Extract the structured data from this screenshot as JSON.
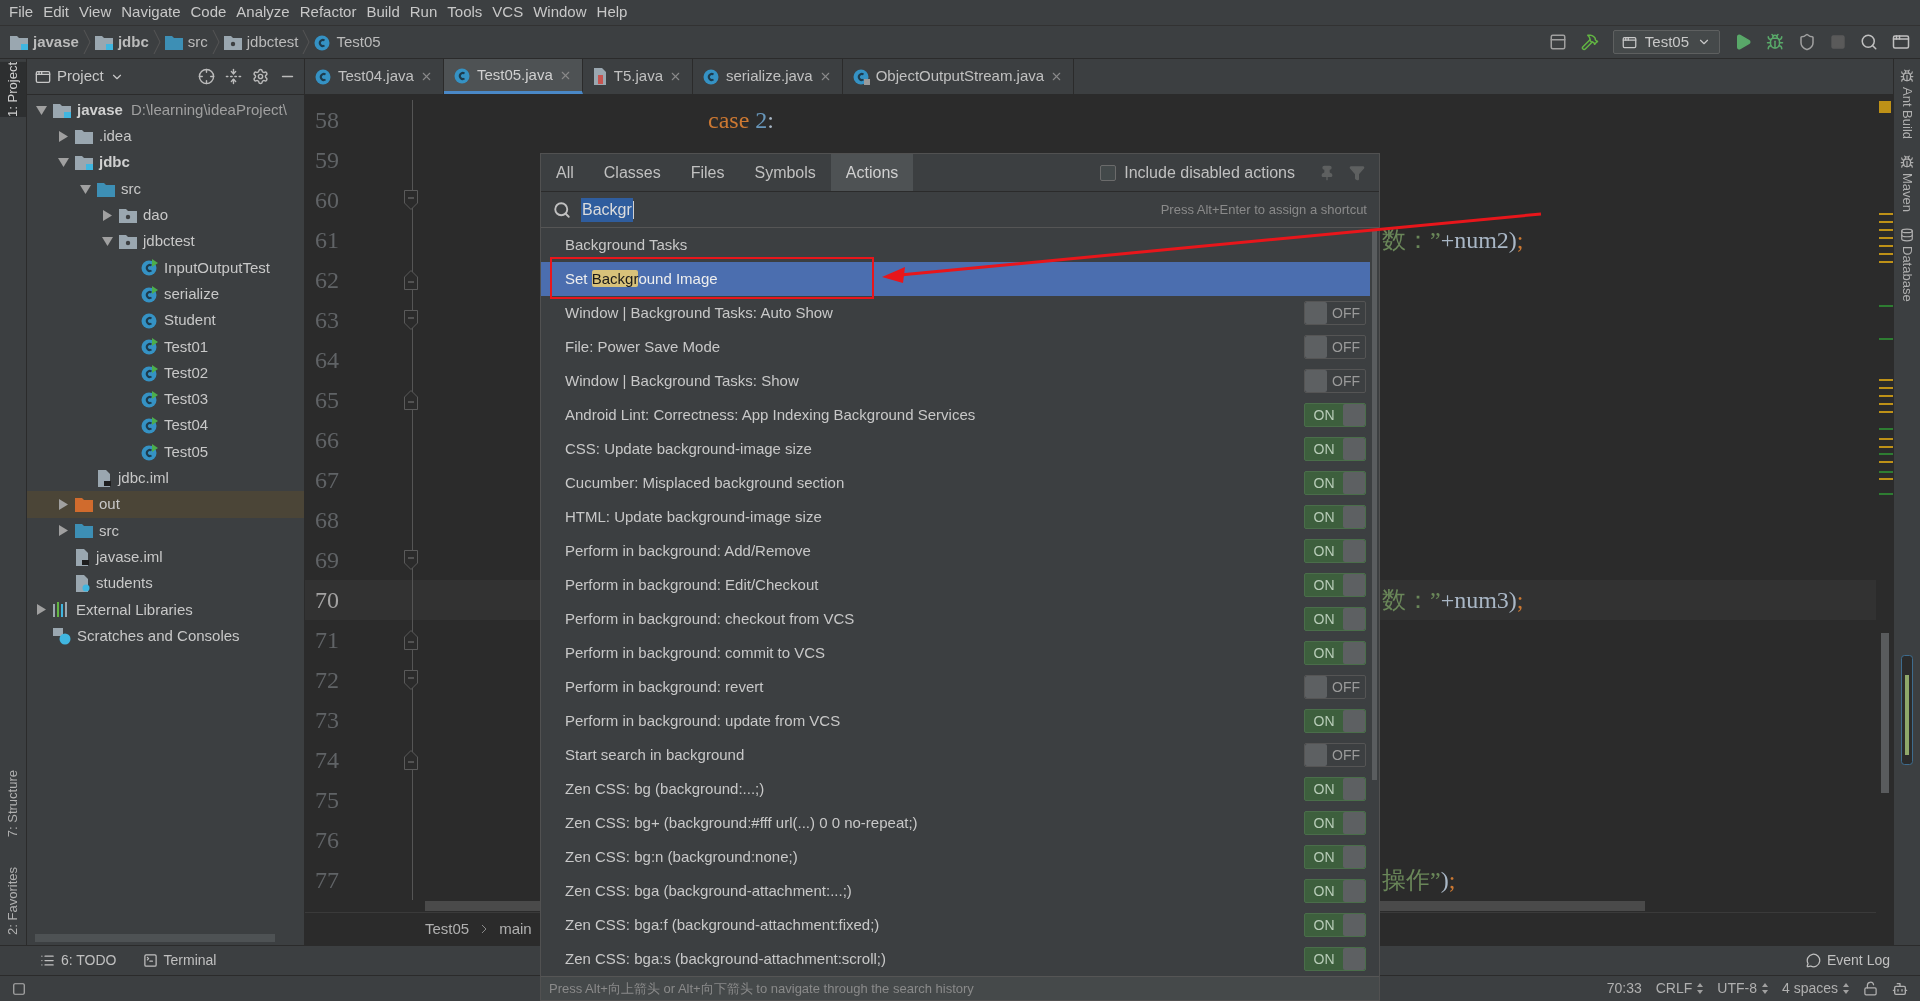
{
  "menu": [
    "File",
    "Edit",
    "View",
    "Navigate",
    "Code",
    "Analyze",
    "Refactor",
    "Build",
    "Run",
    "Tools",
    "VCS",
    "Window",
    "Help"
  ],
  "breadcrumbs": [
    {
      "label": "javase",
      "kind": "module"
    },
    {
      "label": "jdbc",
      "kind": "module"
    },
    {
      "label": "src",
      "kind": "source-folder"
    },
    {
      "label": "jdbctest",
      "kind": "package"
    },
    {
      "label": "Test05",
      "kind": "class"
    }
  ],
  "run_config": "Test05",
  "left_stripe": [
    {
      "label": "1: Project",
      "selected": true
    },
    {
      "label": "7: Structure",
      "selected": false
    },
    {
      "label": "2: Favorites",
      "selected": false
    }
  ],
  "project_panel": {
    "title": "Project",
    "tree": [
      {
        "label": "javase",
        "kind": "module",
        "note": "D:\\learning\\ideaProject\\",
        "expanded": true,
        "selected": false,
        "children": [
          {
            "label": ".idea",
            "kind": "folder",
            "expanded": false,
            "selected": false
          },
          {
            "label": "jdbc",
            "kind": "module",
            "expanded": true,
            "selected": false,
            "children": [
              {
                "label": "src",
                "kind": "source-folder",
                "expanded": true,
                "selected": false,
                "children": [
                  {
                    "label": "dao",
                    "kind": "package",
                    "expanded": false,
                    "selected": false
                  },
                  {
                    "label": "jdbctest",
                    "kind": "package",
                    "expanded": true,
                    "selected": false,
                    "children": [
                      {
                        "label": "InputOutputTest",
                        "kind": "runnable-class",
                        "selected": false
                      },
                      {
                        "label": "serialize",
                        "kind": "runnable-class",
                        "selected": false
                      },
                      {
                        "label": "Student",
                        "kind": "class",
                        "selected": false
                      },
                      {
                        "label": "Test01",
                        "kind": "runnable-class",
                        "selected": false
                      },
                      {
                        "label": "Test02",
                        "kind": "runnable-class",
                        "selected": false
                      },
                      {
                        "label": "Test03",
                        "kind": "runnable-class",
                        "selected": false
                      },
                      {
                        "label": "Test04",
                        "kind": "runnable-class",
                        "selected": false
                      },
                      {
                        "label": "Test05",
                        "kind": "runnable-class",
                        "selected": false
                      }
                    ]
                  }
                ]
              },
              {
                "label": "jdbc.iml",
                "kind": "iml",
                "selected": false
              }
            ]
          },
          {
            "label": "out",
            "kind": "excluded-folder",
            "expanded": false,
            "selected": true
          },
          {
            "label": "src",
            "kind": "source-folder",
            "expanded": false,
            "selected": false
          },
          {
            "label": "javase.iml",
            "kind": "iml",
            "selected": false
          },
          {
            "label": "students",
            "kind": "unknown-file",
            "selected": false
          }
        ]
      },
      {
        "label": "External Libraries",
        "kind": "libraries",
        "expanded": false,
        "selected": false
      },
      {
        "label": "Scratches and Consoles",
        "kind": "scratches",
        "selected": false
      }
    ]
  },
  "editor_tabs": [
    {
      "label": "Test04.java",
      "kind": "class",
      "selected": false
    },
    {
      "label": "Test05.java",
      "kind": "class",
      "selected": true
    },
    {
      "label": "T5.java",
      "kind": "java-file",
      "selected": false
    },
    {
      "label": "serialize.java",
      "kind": "class",
      "selected": false
    },
    {
      "label": "ObjectOutputStream.java",
      "kind": "library-class",
      "selected": false
    }
  ],
  "editor": {
    "lines": [
      {
        "number": "58",
        "current": false,
        "code": [
          {
            "text": "case",
            "kind": "keyword"
          },
          {
            "text": " 2",
            "kind": "number"
          },
          {
            "text": ":",
            "kind": "plain"
          }
        ]
      },
      {
        "number": "59",
        "current": false
      },
      {
        "number": "60",
        "current": false,
        "fold_marker": {
          "kind": "start"
        }
      },
      {
        "number": "61",
        "current": false,
        "tail": [
          {
            "text": "数：”",
            "kind": "string"
          },
          {
            "text": "+num2)",
            "kind": "plain"
          },
          {
            "text": ";",
            "kind": "keyword"
          }
        ]
      },
      {
        "number": "62",
        "current": false,
        "fold_marker": {
          "kind": "end"
        }
      },
      {
        "number": "63",
        "current": false,
        "fold_marker": {
          "kind": "start"
        }
      },
      {
        "number": "64",
        "current": false
      },
      {
        "number": "65",
        "current": false,
        "fold_marker": {
          "kind": "end"
        }
      },
      {
        "number": "66",
        "current": false
      },
      {
        "number": "67",
        "current": false
      },
      {
        "number": "68",
        "current": false
      },
      {
        "number": "69",
        "current": false,
        "fold_marker": {
          "kind": "start"
        }
      },
      {
        "number": "70",
        "current": true,
        "tail": [
          {
            "text": "数：”",
            "kind": "string"
          },
          {
            "text": "+num3)",
            "kind": "plain"
          },
          {
            "text": ";",
            "kind": "keyword"
          }
        ]
      },
      {
        "number": "71",
        "current": false,
        "fold_marker": {
          "kind": "end"
        }
      },
      {
        "number": "72",
        "current": false,
        "fold_marker": {
          "kind": "start"
        }
      },
      {
        "number": "73",
        "current": false
      },
      {
        "number": "74",
        "current": false,
        "fold_marker": {
          "kind": "end"
        }
      },
      {
        "number": "75",
        "current": false
      },
      {
        "number": "76",
        "current": false
      },
      {
        "number": "77",
        "current": false,
        "tail": [
          {
            "text": "操作”",
            "kind": "string"
          },
          {
            "text": ")",
            "kind": "plain"
          },
          {
            "text": ";",
            "kind": "keyword"
          }
        ]
      }
    ],
    "breadcrumb": [
      "Test05",
      "main"
    ]
  },
  "right_stripe": [
    "Ant Build",
    "Maven",
    "Database"
  ],
  "popup": {
    "tabs": [
      {
        "label": "All",
        "selected": false
      },
      {
        "label": "Classes",
        "selected": false
      },
      {
        "label": "Files",
        "selected": false
      },
      {
        "label": "Symbols",
        "selected": false
      },
      {
        "label": "Actions",
        "selected": true
      }
    ],
    "include_disabled": {
      "label": "Include disabled actions",
      "checked": false
    },
    "search": {
      "value": "Backgr"
    },
    "hint": "Press Alt+Enter to assign a shortcut",
    "items": [
      {
        "kind": "action",
        "selected": false,
        "label": [
          {
            "text": "Background Tasks",
            "match": false
          }
        ]
      },
      {
        "kind": "action",
        "selected": true,
        "label": [
          {
            "text": "Set ",
            "match": false
          },
          {
            "text": "Backgr",
            "match": true
          },
          {
            "text": "ound Image",
            "match": false
          }
        ]
      },
      {
        "kind": "toggle",
        "selected": false,
        "on": false,
        "toggle_text": "OFF",
        "label": [
          {
            "text": "Window | Background Tasks: Auto Show",
            "match": false
          }
        ]
      },
      {
        "kind": "toggle",
        "selected": false,
        "on": false,
        "toggle_text": "OFF",
        "label": [
          {
            "text": "File: Power Save Mode",
            "match": false
          }
        ]
      },
      {
        "kind": "toggle",
        "selected": false,
        "on": false,
        "toggle_text": "OFF",
        "label": [
          {
            "text": "Window | Background Tasks: Show",
            "match": false
          }
        ]
      },
      {
        "kind": "toggle",
        "selected": false,
        "on": true,
        "toggle_text": "ON",
        "label": [
          {
            "text": "Android Lint: Correctness: App Indexing Background Services",
            "match": false
          }
        ]
      },
      {
        "kind": "toggle",
        "selected": false,
        "on": true,
        "toggle_text": "ON",
        "label": [
          {
            "text": "CSS: Update background-image size",
            "match": false
          }
        ]
      },
      {
        "kind": "toggle",
        "selected": false,
        "on": true,
        "toggle_text": "ON",
        "label": [
          {
            "text": "Cucumber: Misplaced background section",
            "match": false
          }
        ]
      },
      {
        "kind": "toggle",
        "selected": false,
        "on": true,
        "toggle_text": "ON",
        "label": [
          {
            "text": "HTML: Update background-image size",
            "match": false
          }
        ]
      },
      {
        "kind": "toggle",
        "selected": false,
        "on": true,
        "toggle_text": "ON",
        "label": [
          {
            "text": "Perform in background: Add/Remove",
            "match": false
          }
        ]
      },
      {
        "kind": "toggle",
        "selected": false,
        "on": true,
        "toggle_text": "ON",
        "label": [
          {
            "text": "Perform in background: Edit/Checkout",
            "match": false
          }
        ]
      },
      {
        "kind": "toggle",
        "selected": false,
        "on": true,
        "toggle_text": "ON",
        "label": [
          {
            "text": "Perform in background: checkout from VCS",
            "match": false
          }
        ]
      },
      {
        "kind": "toggle",
        "selected": false,
        "on": true,
        "toggle_text": "ON",
        "label": [
          {
            "text": "Perform in background: commit to VCS",
            "match": false
          }
        ]
      },
      {
        "kind": "toggle",
        "selected": false,
        "on": false,
        "toggle_text": "OFF",
        "label": [
          {
            "text": "Perform in background: revert",
            "match": false
          }
        ]
      },
      {
        "kind": "toggle",
        "selected": false,
        "on": true,
        "toggle_text": "ON",
        "label": [
          {
            "text": "Perform in background: update from VCS",
            "match": false
          }
        ]
      },
      {
        "kind": "toggle",
        "selected": false,
        "on": false,
        "toggle_text": "OFF",
        "label": [
          {
            "text": "Start search in background",
            "match": false
          }
        ]
      },
      {
        "kind": "toggle",
        "selected": false,
        "on": true,
        "toggle_text": "ON",
        "label": [
          {
            "text": "Zen CSS: bg (background:...;)",
            "match": false
          }
        ]
      },
      {
        "kind": "toggle",
        "selected": false,
        "on": true,
        "toggle_text": "ON",
        "label": [
          {
            "text": "Zen CSS: bg+ (background:#fff url(...) 0 0 no-repeat;)",
            "match": false
          }
        ]
      },
      {
        "kind": "toggle",
        "selected": false,
        "on": true,
        "toggle_text": "ON",
        "label": [
          {
            "text": "Zen CSS: bg:n (background:none;)",
            "match": false
          }
        ]
      },
      {
        "kind": "toggle",
        "selected": false,
        "on": true,
        "toggle_text": "ON",
        "label": [
          {
            "text": "Zen CSS: bga (background-attachment:...;)",
            "match": false
          }
        ]
      },
      {
        "kind": "toggle",
        "selected": false,
        "on": true,
        "toggle_text": "ON",
        "label": [
          {
            "text": "Zen CSS: bga:f (background-attachment:fixed;)",
            "match": false
          }
        ]
      },
      {
        "kind": "toggle",
        "selected": false,
        "on": true,
        "toggle_text": "ON",
        "label": [
          {
            "text": "Zen CSS: bga:s (background-attachment:scroll;)",
            "match": false
          }
        ]
      }
    ],
    "footer": "Press Alt+向上箭头 or Alt+向下箭头 to navigate through the search history"
  },
  "bottom_tools": [
    {
      "label": "6: TODO",
      "kind": "todo"
    },
    {
      "label": "Terminal",
      "kind": "terminal"
    }
  ],
  "event_log": "Event Log",
  "status": [
    "70:33",
    "CRLF",
    "UTF-8",
    "4 spaces"
  ]
}
